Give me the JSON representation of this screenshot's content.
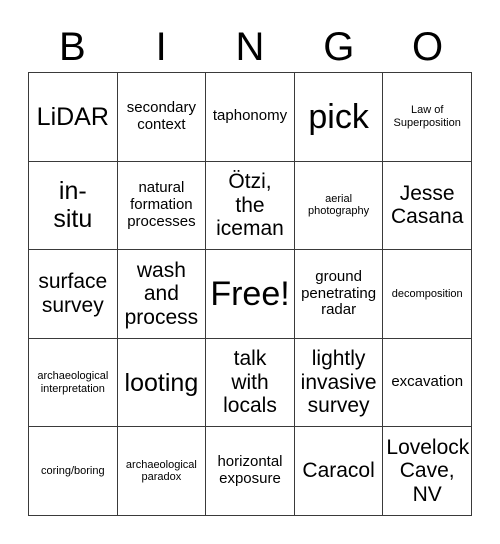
{
  "header": {
    "letters": [
      "B",
      "I",
      "N",
      "G",
      "O"
    ]
  },
  "grid": {
    "rows": 5,
    "columns": 5,
    "border_color": "#3a3a3a",
    "background_color": "#ffffff",
    "text_color": "#000000",
    "cells": [
      {
        "text": "LiDAR",
        "size": "t-lg"
      },
      {
        "text": "secondary\ncontext",
        "size": "t-sm"
      },
      {
        "text": "taphonomy",
        "size": "t-sm"
      },
      {
        "text": "pick",
        "size": "t-xl"
      },
      {
        "text": "Law of\nSuperposition",
        "size": "t-xs"
      },
      {
        "text": "in-\nsitu",
        "size": "t-lg"
      },
      {
        "text": "natural\nformation\nprocesses",
        "size": "t-sm"
      },
      {
        "text": "Ötzi,\nthe\niceman",
        "size": "t-md"
      },
      {
        "text": "aerial\nphotography",
        "size": "t-xs"
      },
      {
        "text": "Jesse\nCasana",
        "size": "t-md"
      },
      {
        "text": "surface\nsurvey",
        "size": "t-md"
      },
      {
        "text": "wash\nand\nprocess",
        "size": "t-md"
      },
      {
        "text": "Free!",
        "size": "t-xl"
      },
      {
        "text": "ground\npenetrating\nradar",
        "size": "t-sm"
      },
      {
        "text": "decomposition",
        "size": "t-xs"
      },
      {
        "text": "archaeological\ninterpretation",
        "size": "t-xs"
      },
      {
        "text": "looting",
        "size": "t-lg"
      },
      {
        "text": "talk\nwith\nlocals",
        "size": "t-md"
      },
      {
        "text": "lightly\ninvasive\nsurvey",
        "size": "t-md"
      },
      {
        "text": "excavation",
        "size": "t-sm"
      },
      {
        "text": "coring/boring",
        "size": "t-xs"
      },
      {
        "text": "archaeological\nparadox",
        "size": "t-xs"
      },
      {
        "text": "horizontal\nexposure",
        "size": "t-sm"
      },
      {
        "text": "Caracol",
        "size": "t-md"
      },
      {
        "text": "Lovelock\nCave,\nNV",
        "size": "t-md"
      }
    ]
  }
}
